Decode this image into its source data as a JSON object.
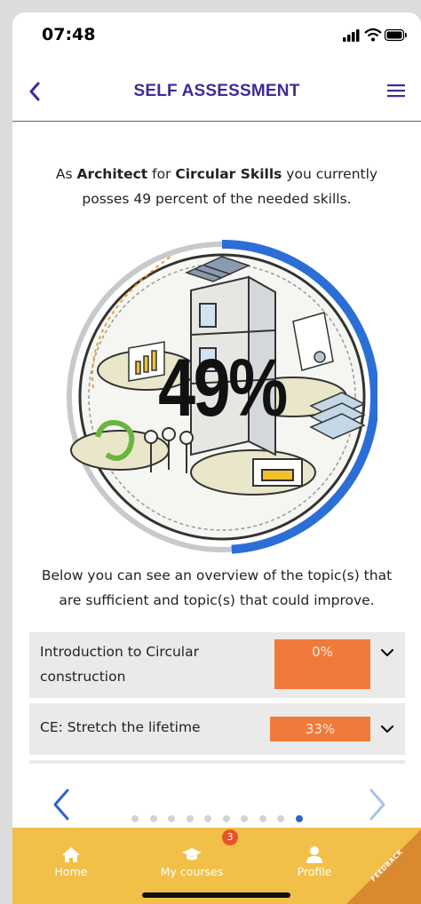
{
  "status_bar": {
    "time": "07:48"
  },
  "header": {
    "title": "SELF ASSESSMENT"
  },
  "intro": {
    "prefix": "As ",
    "role": "Architect",
    "middle": " for ",
    "skill_area": "Circular Skills",
    "suffix": " you currently posses 49 percent of the needed skills."
  },
  "score": {
    "value": 49,
    "label": "49%"
  },
  "overview_text": "Below you can see an overview of the topic(s) that are sufficient and topic(s) that could improve.",
  "topics": [
    {
      "name": "Introduction to Circular construction",
      "percent": 0,
      "percent_label": "0%"
    },
    {
      "name": "CE: Stretch the lifetime",
      "percent": 33,
      "percent_label": "33%"
    }
  ],
  "carousel": {
    "page_count": 10,
    "active_index": 9
  },
  "tabbar": {
    "items": [
      {
        "label": "Home",
        "icon": "home-icon"
      },
      {
        "label": "My courses",
        "icon": "graduation-cap-icon",
        "badge": "3"
      },
      {
        "label": "Profile",
        "icon": "person-icon"
      }
    ]
  },
  "feedback_label": "FEEDBACK",
  "colors": {
    "title": "#3a2d96",
    "bar": "#ef7a3c",
    "tabbar": "#f2bf48",
    "gauge_arc": "#2b6fd6",
    "dot_active": "#2b66c8",
    "badge": "#e5532b"
  }
}
